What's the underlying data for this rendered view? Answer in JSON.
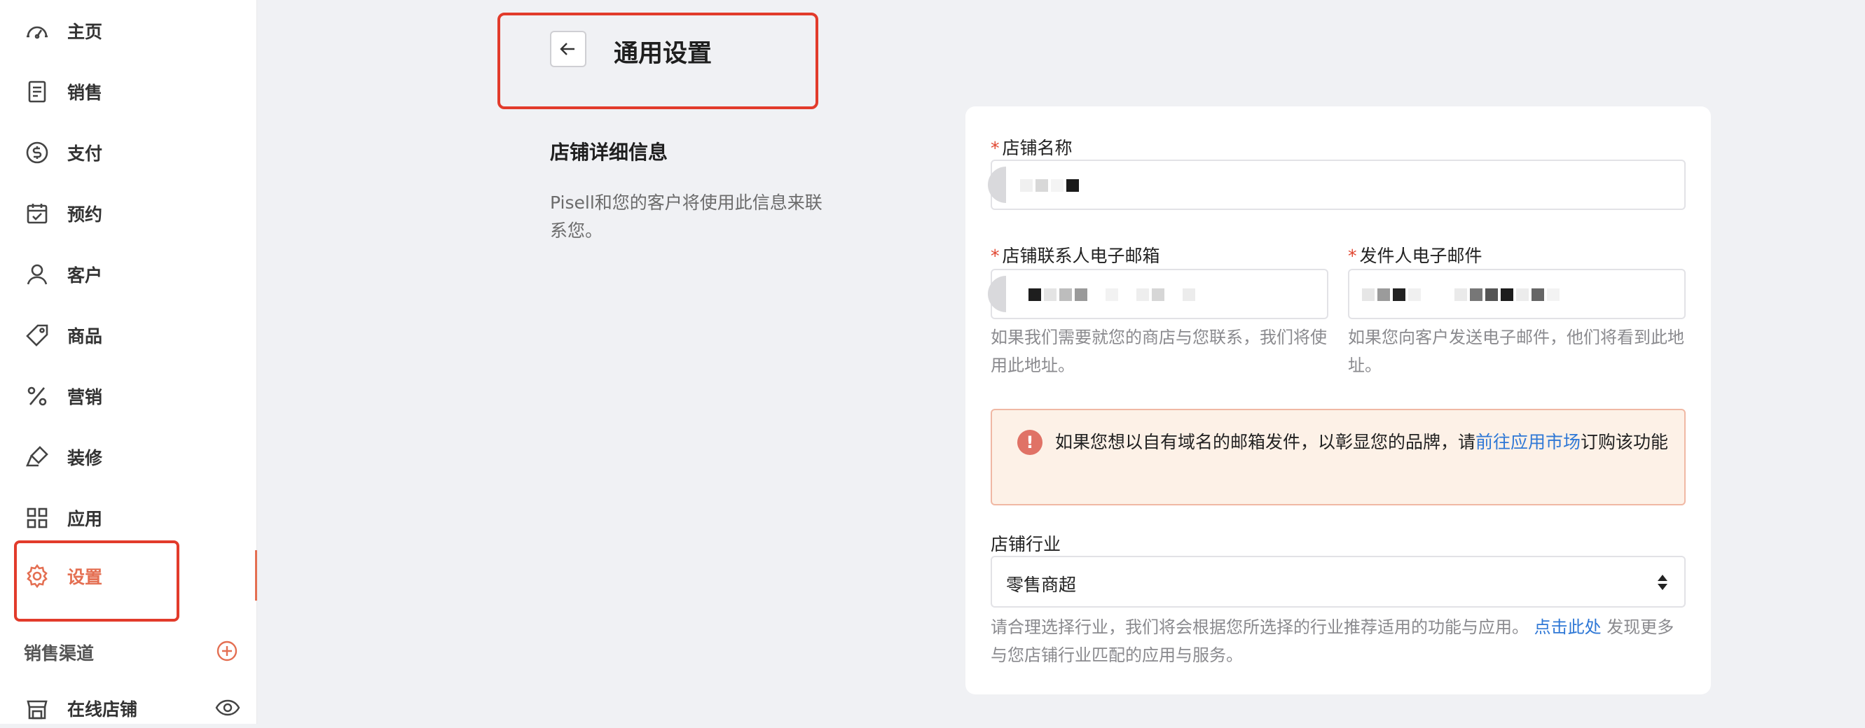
{
  "sidebar": {
    "items": [
      {
        "label": "主页",
        "icon": "dashboard-icon"
      },
      {
        "label": "销售",
        "icon": "receipt-icon"
      },
      {
        "label": "支付",
        "icon": "dollar-icon"
      },
      {
        "label": "预约",
        "icon": "calendar-icon"
      },
      {
        "label": "客户",
        "icon": "user-icon"
      },
      {
        "label": "商品",
        "icon": "tag-icon"
      },
      {
        "label": "营销",
        "icon": "percent-icon"
      },
      {
        "label": "装修",
        "icon": "brush-icon"
      },
      {
        "label": "应用",
        "icon": "grid-icon"
      },
      {
        "label": "设置",
        "icon": "gear-icon",
        "active": true
      }
    ],
    "channels_title": "销售渠道",
    "online_store_label": "在线店铺",
    "accent_color": "#e46f52"
  },
  "header": {
    "title": "通用设置"
  },
  "store_details": {
    "heading": "店铺详细信息",
    "description": "Pisell和您的客户将使用此信息来联系您。"
  },
  "form": {
    "store_name_label": "店铺名称",
    "contact_email_label": "店铺联系人电子邮箱",
    "contact_email_help": "如果我们需要就您的商店与您联系，我们将使用此地址。",
    "sender_email_label": "发件人电子邮件",
    "sender_email_help": "如果您向客户发送电子邮件，他们将看到此地址。",
    "alert_text_before": "如果您想以自有域名的邮箱发件，以彰显您的品牌，请",
    "alert_link": "前往应用市场",
    "alert_text_after": "订购该功能",
    "industry_label": "店铺行业",
    "industry_value": "零售商超",
    "industry_help_before": "请合理选择行业，我们将会根据您所选择的行业推荐适用的功能与应用。 ",
    "industry_help_link": "点击此处",
    "industry_help_after": " 发现更多与您店铺行业匹配的应用与服务。"
  }
}
